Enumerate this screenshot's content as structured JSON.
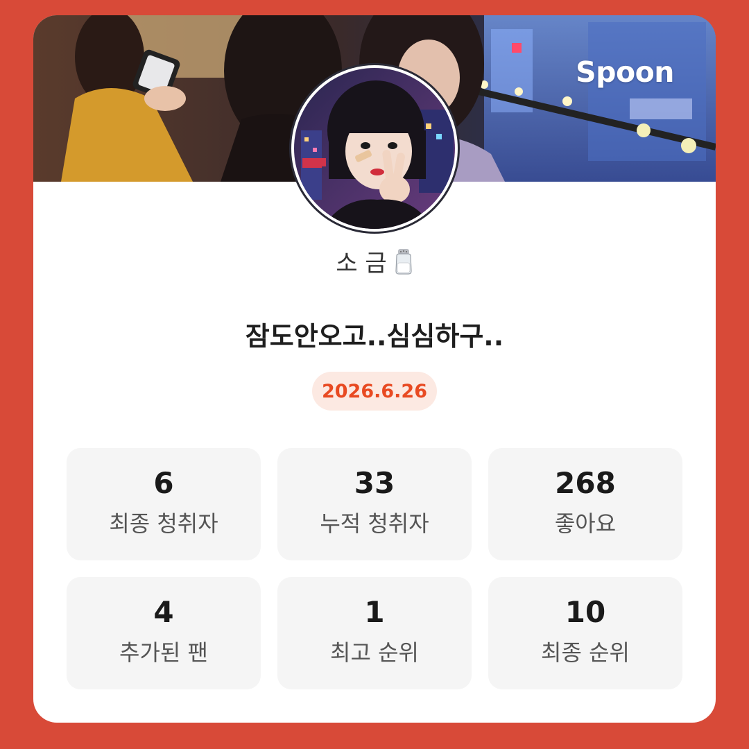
{
  "brand": {
    "name": "Spoon"
  },
  "profile": {
    "nickname": "소 금",
    "nickname_icon": "salt-shaker-emoji-icon",
    "broadcast_title": "잠도안오고..심심하구..",
    "date": "2026.6.26"
  },
  "stats": [
    {
      "value": "6",
      "label": "최종 청취자"
    },
    {
      "value": "33",
      "label": "누적 청취자"
    },
    {
      "value": "268",
      "label": "좋아요"
    },
    {
      "value": "4",
      "label": "추가된 팬"
    },
    {
      "value": "1",
      "label": "최고 순위"
    },
    {
      "value": "10",
      "label": "최종 순위"
    }
  ],
  "colors": {
    "background": "#D84A38",
    "card": "#FFFFFF",
    "badge_bg": "#FCE9E2",
    "badge_text": "#E84A22",
    "stat_bg": "#F5F5F5"
  }
}
